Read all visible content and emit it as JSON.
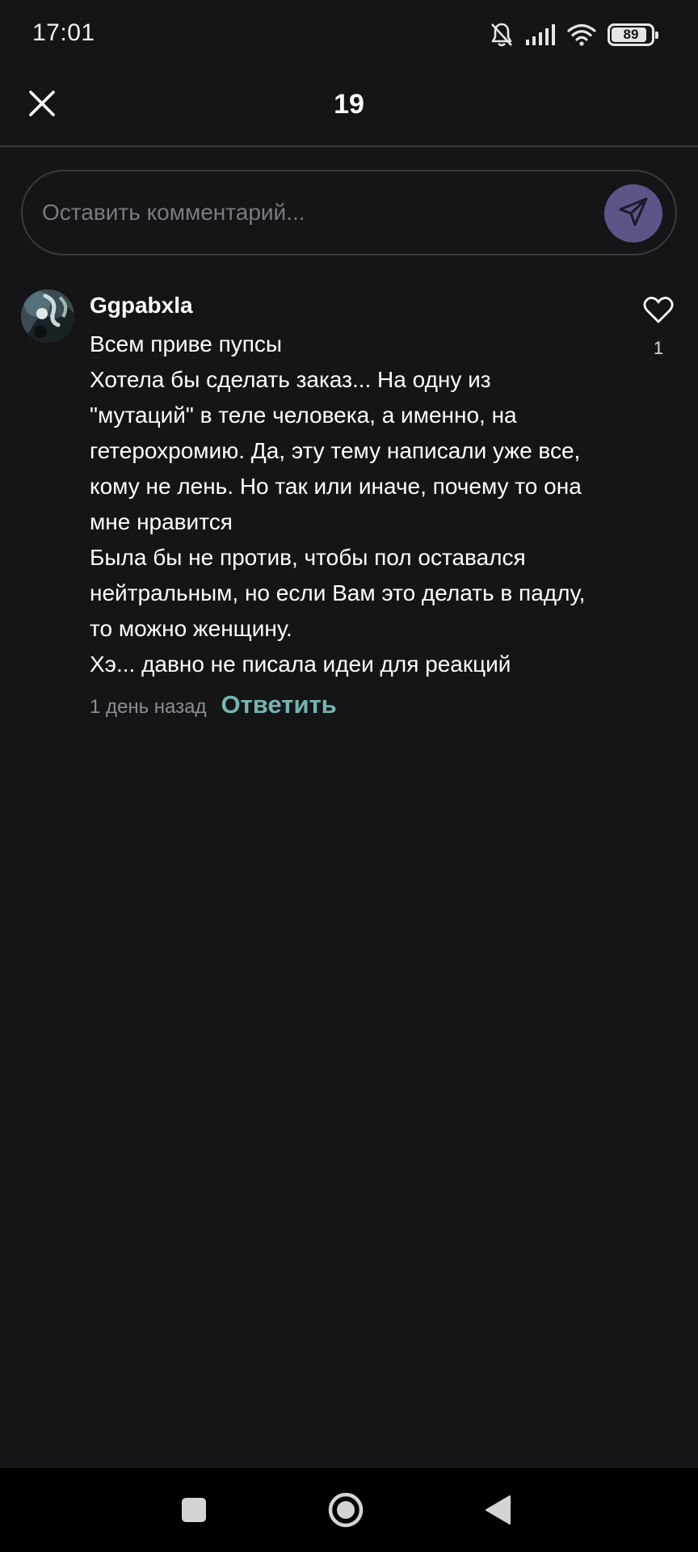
{
  "status_bar": {
    "time": "17:01",
    "icons": [
      "bell-off-icon",
      "signal-icon",
      "wifi-icon",
      "battery-icon"
    ],
    "battery_level": "89",
    "battery_fraction": 0.89
  },
  "header": {
    "title": "19",
    "close_icon": "close-icon"
  },
  "comment_input": {
    "placeholder": "Оставить комментарий...",
    "value": "",
    "send_icon": "send-icon"
  },
  "comments": [
    {
      "author": "Ggpabxla",
      "lines": [
        "Всем приве пупсы",
        "Хотела бы сделать заказ... На одну из",
        "\"мутаций\" в теле человека, а именно, на",
        "гетерохромию. Да, эту тему написали уже все,",
        "кому не лень. Но так или иначе, почему то она",
        "мне нравится",
        "Была бы не против, чтобы пол оставался",
        "нейтральным, но если Вам это делать в падлу,",
        "то можно женщину.",
        "Хэ... давно не писала идеи для реакций"
      ],
      "time_ago": "1 день назад",
      "reply_label": "Ответить",
      "likes": "1"
    }
  ],
  "nav_bar": {
    "buttons": [
      "recents-square-icon",
      "home-circle-icon",
      "back-triangle-icon"
    ]
  },
  "colors": {
    "background": "#151417",
    "accent_send": "#5d5488",
    "reply_link": "#74b5b0",
    "muted_text": "#8e8d93",
    "divider": "#3a393d"
  }
}
